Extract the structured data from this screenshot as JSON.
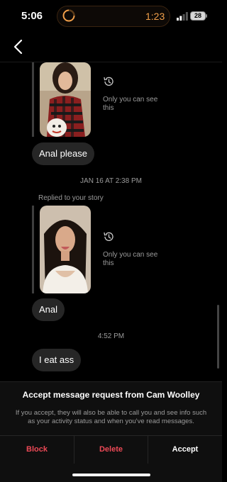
{
  "status_bar": {
    "time": "5:06",
    "timer": "1:23",
    "battery": "28"
  },
  "messages": {
    "story1_note": "Only you can see this",
    "msg1": "Anal please",
    "timestamp1": "JAN 16 AT 2:38 PM",
    "replied_label": "Replied to your story",
    "story2_note": "Only you can see this",
    "msg2": "Anal",
    "timestamp2": "4:52 PM",
    "msg3": "I eat ass"
  },
  "request": {
    "title": "Accept message request from Cam Woolley",
    "body": "If you accept, they will also be able to call you and see info such as your activity status and when you've read messages.",
    "block": "Block",
    "delete": "Delete",
    "accept": "Accept"
  },
  "colors": {
    "danger": "#ed4956",
    "timer": "#f2a04a",
    "bubble": "#262626"
  }
}
